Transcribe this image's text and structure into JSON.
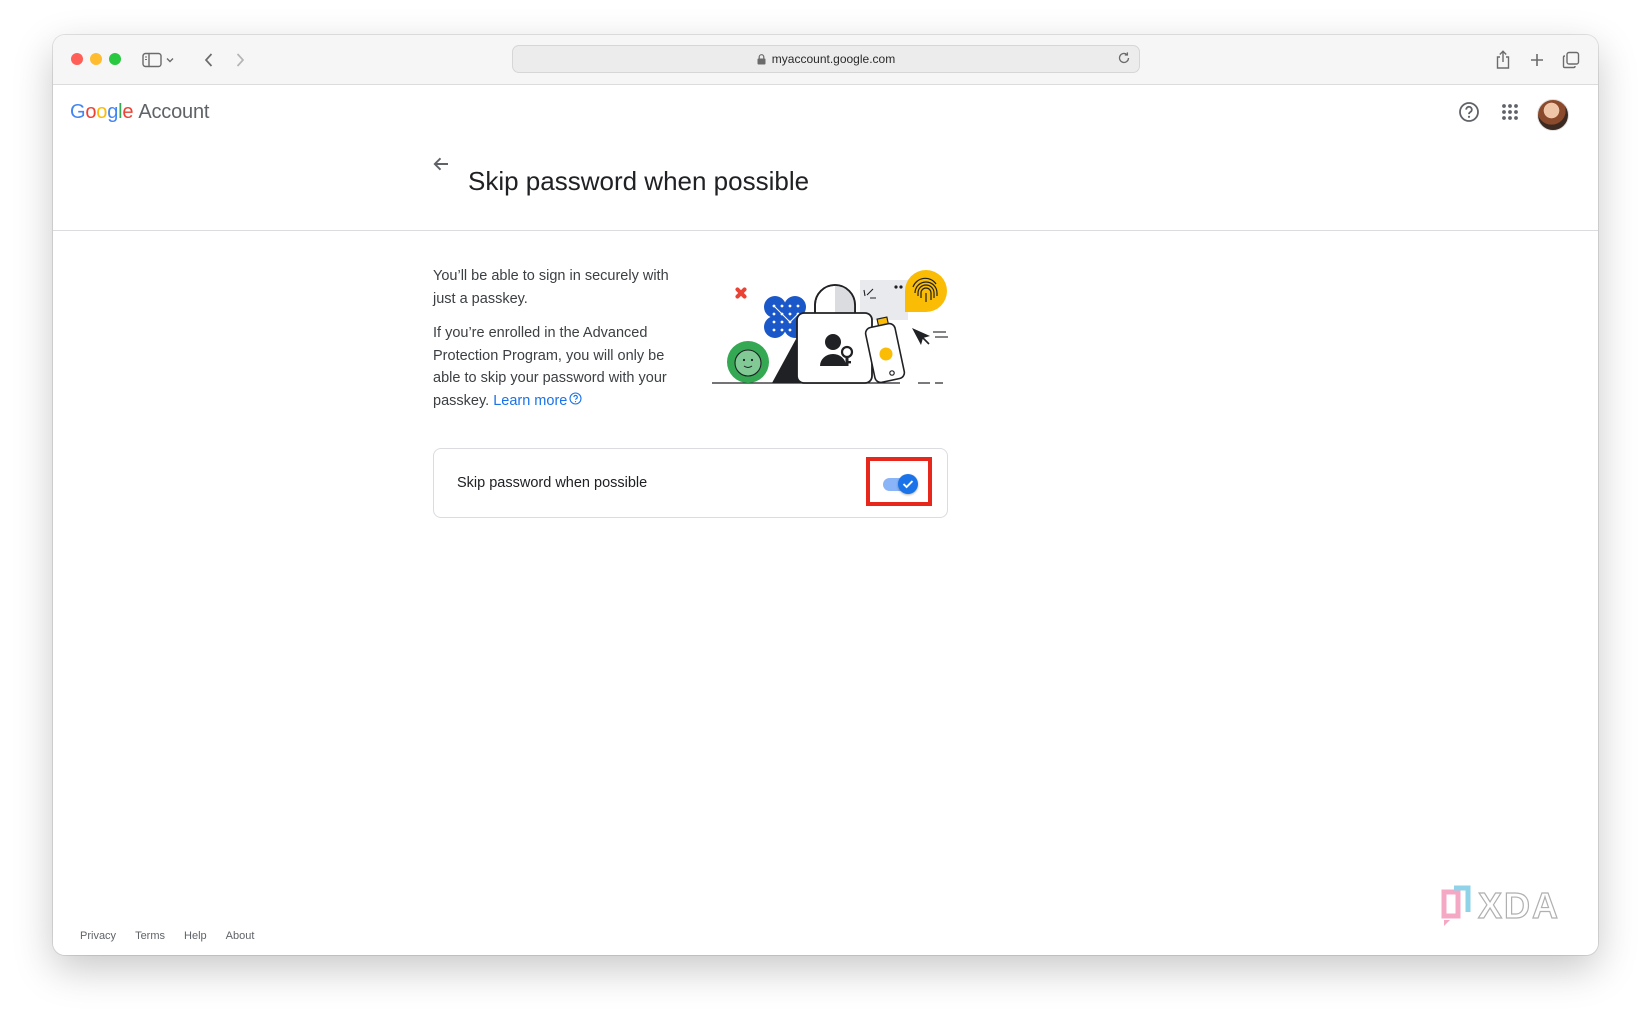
{
  "browser": {
    "url": "myaccount.google.com"
  },
  "header": {
    "logo_letters": [
      "G",
      "o",
      "o",
      "g",
      "l",
      "e"
    ],
    "logo_colors": [
      "#4285F4",
      "#EA4335",
      "#FBBC05",
      "#4285F4",
      "#34A853",
      "#EA4335"
    ],
    "product": "Account"
  },
  "page": {
    "title": "Skip password when possible",
    "paragraph1": "You’ll be able to sign in securely with just a passkey.",
    "paragraph2": "If you’re enrolled in the Advanced Protection Program, you will only be able to skip your password with your passkey.",
    "learn_more": "Learn more"
  },
  "setting": {
    "label": "Skip password when possible",
    "enabled": true
  },
  "footer": {
    "links": [
      "Privacy",
      "Terms",
      "Help",
      "About"
    ]
  },
  "watermark": "XDA",
  "colors": {
    "accent": "#1a73e8",
    "highlight": "#e8271c"
  }
}
